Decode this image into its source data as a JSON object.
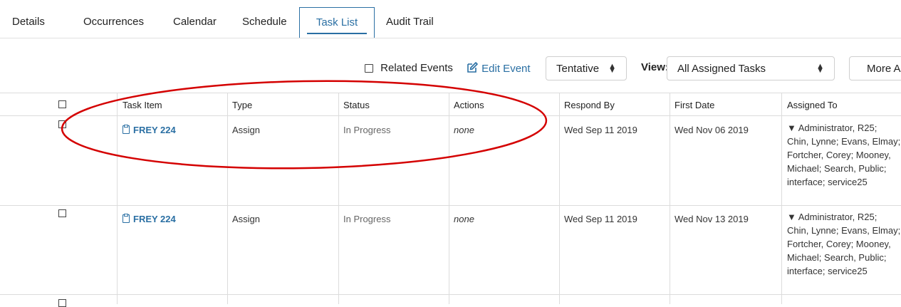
{
  "tabs": [
    {
      "label": "Details"
    },
    {
      "label": "Occurrences"
    },
    {
      "label": "Calendar"
    },
    {
      "label": "Schedule"
    },
    {
      "label": "Task List"
    },
    {
      "label": "Audit Trail"
    }
  ],
  "toolbar": {
    "related_events_label": "Related Events",
    "edit_event_label": "Edit Event",
    "state_select_value": "Tentative",
    "view_label": "View:",
    "view_select_value": "All Assigned Tasks",
    "more_actions_label": "More Ac"
  },
  "table": {
    "headers": {
      "task_item": "Task Item",
      "type": "Type",
      "status": "Status",
      "actions": "Actions",
      "respond_by": "Respond By",
      "first_date": "First Date",
      "assigned_to": "Assigned To"
    },
    "rows": [
      {
        "task_item": "FREY 224",
        "type": "Assign",
        "status": "In Progress",
        "actions": "none",
        "respond_by": "Wed Sep 11 2019",
        "first_date": "Wed Nov 06 2019",
        "assigned_to": "▼ Administrator, R25; Chin, Lynne; Evans, Elmay; Fortcher, Corey; Mooney, Michael; Search, Public; interface; service25"
      },
      {
        "task_item": "FREY 224",
        "type": "Assign",
        "status": "In Progress",
        "actions": "none",
        "respond_by": "Wed Sep 11 2019",
        "first_date": "Wed Nov 13 2019",
        "assigned_to": "▼ Administrator, R25; Chin, Lynne; Evans, Elmay; Fortcher, Corey; Mooney, Michael; Search, Public; interface; service25"
      }
    ]
  },
  "colors": {
    "accent": "#2a6fa3",
    "annotation": "#d40000",
    "grid": "#dcdcdc"
  }
}
